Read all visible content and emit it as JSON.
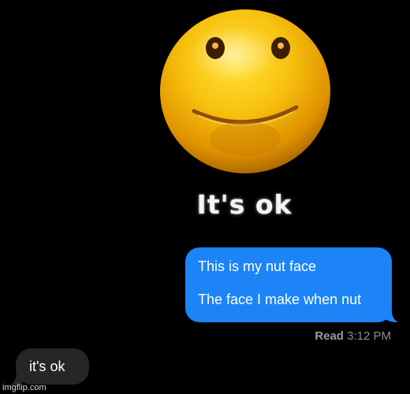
{
  "meme": {
    "caption": "It's ok"
  },
  "conversation": {
    "sent_message": {
      "line1": "This is my nut face",
      "line2": "The face I make when nut",
      "bubble_color": "#1c84f6"
    },
    "receipt": {
      "status": "Read",
      "time": "3:12 PM"
    },
    "received_message": {
      "text": "it's ok",
      "bubble_color": "#262629"
    }
  },
  "watermark": {
    "text": "imgflip.com"
  }
}
